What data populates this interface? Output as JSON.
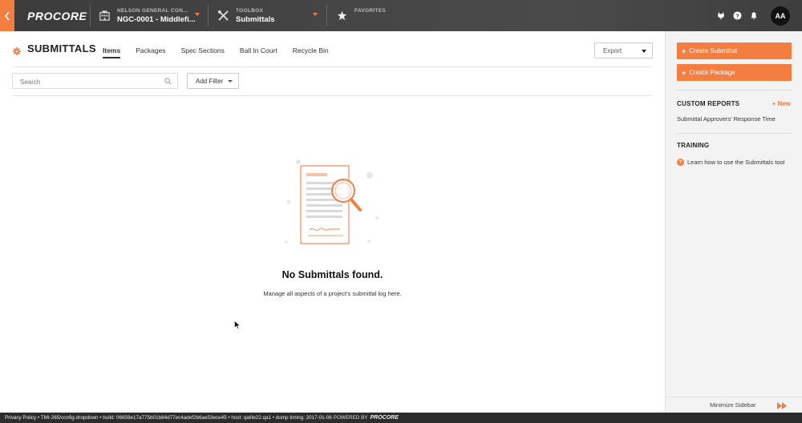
{
  "topbar": {
    "logo": "PROCORE",
    "company_label": "NELSON GENERAL CON...",
    "project_name": "NGC-0001 - Middlefi...",
    "toolbox_label": "TOOLBOX",
    "tool_name": "Submittals",
    "favorites_label": "FAVORITES",
    "avatar_initials": "AA"
  },
  "main": {
    "title": "SUBMITTALS",
    "tabs": [
      "Items",
      "Packages",
      "Spec Sections",
      "Ball In Court",
      "Recycle Bin"
    ],
    "active_tab": "Items",
    "export_label": "Export",
    "search_placeholder": "Search",
    "add_filter_label": "Add Filter",
    "empty_title": "No Submittals found.",
    "empty_subtitle": "Manage all aspects of a project's submittal log here."
  },
  "sidebar": {
    "create_submittal": "Create Submittal",
    "create_package": "Create Package",
    "custom_reports_heading": "CUSTOM REPORTS",
    "new_label": "+ New",
    "report_link": "Submittal Approvers' Response Time",
    "training_heading": "TRAINING",
    "training_link": "Learn how to use the Submittals tool",
    "minimize_label": "Minimize Sidebar"
  },
  "footer": {
    "text": "Privacy Policy • TMI-265/config-dropdown • build: 06859e17a775b01b84d77ec4adef2b6ae53ece45 • host: qalite22.qa1 • dump timing: 2017-01-06",
    "powered_by": "POWERED BY",
    "powered_logo": "PROCORE"
  },
  "colors": {
    "accent": "#f47e42",
    "topbar": "#3a3a3a",
    "footer": "#2c2c2c",
    "sidebar_bg": "#f3f3f3"
  },
  "icons": [
    "back-chevron-icon",
    "building-icon",
    "tools-icon",
    "star-icon",
    "plug-icon",
    "help-icon",
    "bell-icon",
    "gear-icon",
    "search-icon",
    "fast-forward-icon"
  ]
}
